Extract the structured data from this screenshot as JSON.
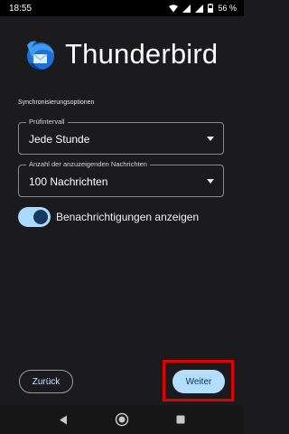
{
  "status_bar": {
    "time": "18:55",
    "battery": "56 %",
    "icons": [
      "wifi-icon",
      "signal-icon",
      "signal-icon",
      "battery-icon"
    ]
  },
  "brand": {
    "title": "Thunderbird",
    "logo_icon": "thunderbird-logo"
  },
  "sync": {
    "section_title": "Synchronisierungsoptionen",
    "check_interval": {
      "label": "Prüfintervall",
      "value": "Jede Stunde"
    },
    "message_count": {
      "label": "Anzahl der anzuzeigenden Nachrichten",
      "value": "100 Nachrichten"
    },
    "notifications": {
      "label": "Benachrichtigungen anzeigen",
      "enabled": true
    }
  },
  "actions": {
    "back_label": "Zurück",
    "next_label": "Weiter"
  },
  "colors": {
    "background": "#1b1b1d",
    "accent": "#b3deff",
    "highlight": "#e00000"
  },
  "nav_bar": {
    "icons": [
      "back-icon",
      "home-icon",
      "recents-icon"
    ]
  }
}
